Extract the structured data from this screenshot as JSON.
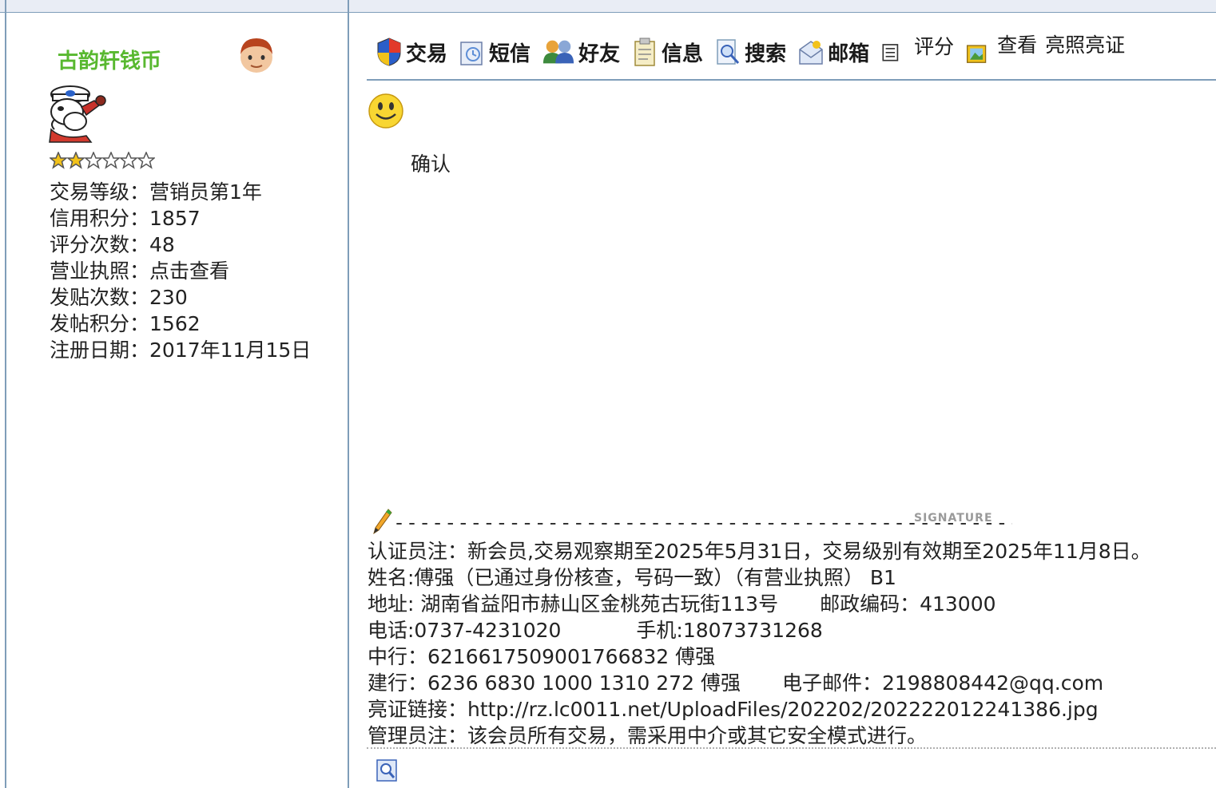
{
  "user": {
    "name": "古韵轩钱币",
    "rating_stars": 2,
    "rating_max": 6,
    "info": [
      {
        "label": "交易等级：",
        "value": "营销员第1年"
      },
      {
        "label": "信用积分：",
        "value": "1857"
      },
      {
        "label": "评分次数：",
        "value": "48"
      },
      {
        "label": "营业执照：",
        "value": "点击查看"
      },
      {
        "label": "发贴次数：",
        "value": "230"
      },
      {
        "label": "发帖积分：",
        "value": "1562"
      },
      {
        "label": "注册日期：",
        "value": "2017年11月15日"
      }
    ]
  },
  "toolbar": {
    "trade": "交易",
    "sms": "短信",
    "friend": "好友",
    "info": "信息",
    "search": "搜索",
    "mail": "邮箱",
    "rate": "评分",
    "view": "查看",
    "license": "亮照亮证"
  },
  "post": {
    "text": "确认"
  },
  "signature": {
    "label": "SIGNATURE",
    "dashes": "--------------------------------------------------",
    "lines": {
      "note": "认证员注：新会员,交易观察期至2025年5月31日，交易级别有效期至2025年11月8日。",
      "name": "姓名:傅强（已通过身份核查，号码一致）（有营业执照） B1",
      "address": "地址: 湖南省益阳市赫山区金桃苑古玩街113号",
      "postcode": "邮政编码：413000",
      "phone": "电话:0737-4231020",
      "mobile": "手机:18073731268",
      "boc": "中行：6216617509001766832  傅强",
      "ccb": "建行：6236 6830 1000 1310 272  傅强",
      "email": "电子邮件：2198808442@qq.com",
      "link_label": "亮证链接：",
      "link_url": "http://rz.lc0011.net/UploadFiles/202202/202222012241386.jpg",
      "admin": "管理员注：该会员所有交易，需采用中介或其它安全模式进行。"
    }
  },
  "colors": {
    "username": "#58b82f",
    "border": "#7f9db9",
    "topbar": "#e9edf5"
  }
}
